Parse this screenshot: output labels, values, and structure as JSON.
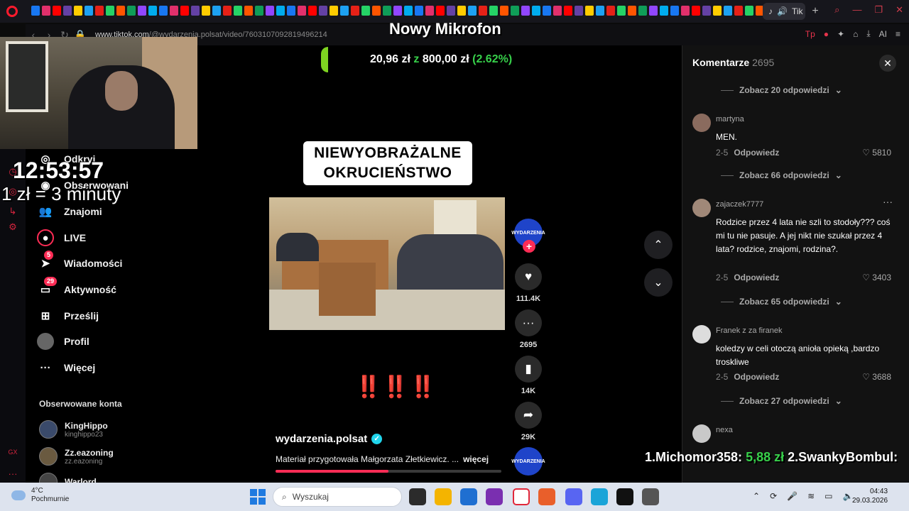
{
  "browser": {
    "url_domain": "www.tiktok.com",
    "url_path": "/@wydarzenia.polsat/video/7603107092819496214",
    "active_tab_label": "Tik",
    "ext_label_ai": "AI"
  },
  "stream": {
    "title": "Nowy Mikrofon",
    "goal_current": "20,96 zł",
    "goal_z": "z",
    "goal_total": "800,00 zł",
    "goal_percent": "(2.62%)",
    "goal_progress": 0.0262,
    "clock": "12:53:57",
    "rate": "1 zł = 3 minuty",
    "ticker_text_1": "1.Michomor358:",
    "ticker_amount_1": "5,88 zł",
    "ticker_text_2": "2.SwankyBombul:"
  },
  "sidebar": {
    "items": [
      {
        "label": "Odkryj",
        "icon": "compass-icon"
      },
      {
        "label": "Obserwowani",
        "icon": "following-icon"
      },
      {
        "label": "Znajomi",
        "icon": "friends-icon"
      },
      {
        "label": "LIVE",
        "icon": "live-icon"
      },
      {
        "label": "Wiadomości",
        "icon": "messages-icon",
        "badge": "5"
      },
      {
        "label": "Aktywność",
        "icon": "activity-icon",
        "badge": "29"
      },
      {
        "label": "Prześlij",
        "icon": "upload-icon"
      },
      {
        "label": "Profil",
        "icon": "profile-icon"
      },
      {
        "label": "Więcej",
        "icon": "more-icon"
      }
    ],
    "followed_title": "Obserwowane konta",
    "accounts": [
      {
        "name": "KingHippo",
        "handle": "kinghippo23"
      },
      {
        "name": "Zz.eazoning",
        "handle": "zz.eazoning"
      },
      {
        "name": "Warlord",
        "handle": ""
      }
    ]
  },
  "video": {
    "headline": "NIEWYOBRAŻALNE OKRUCIEŃSTWO",
    "exclaims": "‼️‼️‼️",
    "author": "wydarzenia.polsat",
    "description": "Materiał przygotowała Małgorzata Złetkiewicz. ...",
    "more": "więcej",
    "progress": 0.5,
    "likes": "111.4K",
    "comments": "2695",
    "saves": "14K",
    "shares": "29K",
    "avatar_label": "WYDARZENIA"
  },
  "comments": {
    "title": "Komentarze",
    "count": "2695",
    "replies": [
      "Zobacz 20 odpowiedzi",
      "Zobacz 66 odpowiedzi",
      "Zobacz 65 odpowiedzi",
      "Zobacz 27 odpowiedzi"
    ],
    "items": [
      {
        "user": "martyna",
        "text": "MEN.",
        "date": "2-5",
        "reply": "Odpowiedz",
        "likes": "5810"
      },
      {
        "user": "zajaczek7777",
        "text": "Rodzice przez 4 lata nie szli to stodoły??? coś mi tu nie pasuje. A jej nikt nie szukał przez 4 lata? rodzice, znajomi, rodzina?.",
        "date": "2-5",
        "reply": "Odpowiedz",
        "likes": "3403"
      },
      {
        "user": "Franek z za firanek",
        "text": "koledzy w celi otoczą anioła opieką ,bardzo troskliwe",
        "date": "2-5",
        "reply": "Odpowiedz",
        "likes": "3688"
      },
      {
        "user": "nexa",
        "text": "",
        "date": "",
        "reply": "",
        "likes": ""
      }
    ]
  },
  "taskbar": {
    "temp": "4°C",
    "weather": "Pochmurnie",
    "search_placeholder": "Wyszukaj",
    "time": "04:43",
    "date": "29.03.2026"
  }
}
